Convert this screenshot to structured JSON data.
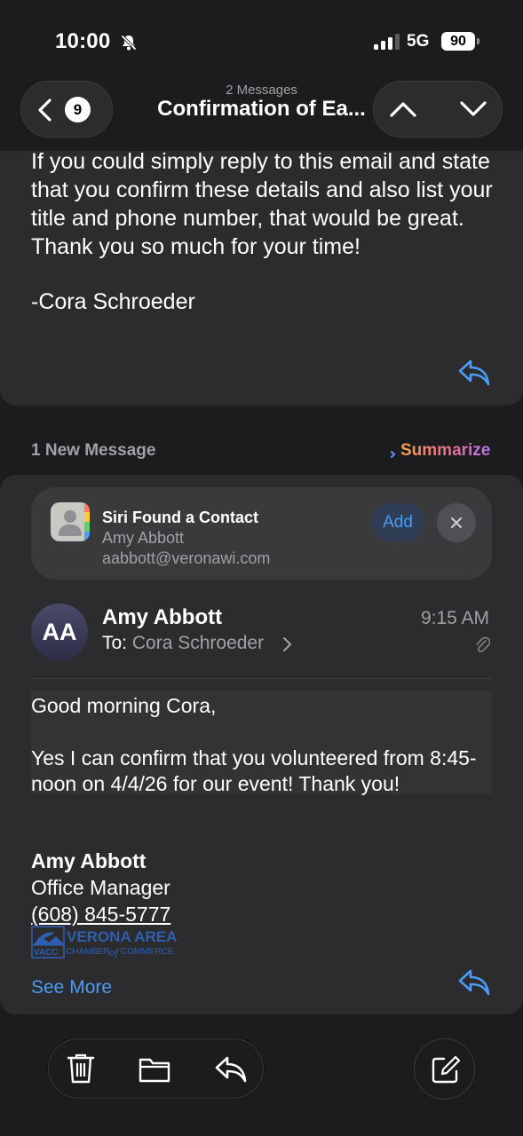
{
  "status_bar": {
    "time": "10:00",
    "network": "5G",
    "battery": "90"
  },
  "nav": {
    "message_count": "9",
    "subtitle": "2 Messages",
    "title": "Confirmation of Ea..."
  },
  "previous_message": {
    "body": "If you could simply reply to this email and state that you confirm these details and also list your title and phone number, that would be great. Thank you so much for your time!",
    "signature": "-Cora Schroeder"
  },
  "new_message_bar": {
    "label": "1 New Message",
    "summarize": "Summarize"
  },
  "siri_contact": {
    "title": "Siri Found a Contact",
    "name": "Amy Abbott",
    "email": "aabbott@veronawi.com",
    "add_label": "Add"
  },
  "message": {
    "avatar_initials": "AA",
    "sender": "Amy Abbott",
    "to_label": "To:",
    "to_name": "Cora Schroeder",
    "time": "9:15 AM",
    "greeting": "Good morning Cora,",
    "body": "Yes I can confirm that you volunteered from 8:45-noon on 4/4/26 for our event! Thank you!",
    "signature_name": "Amy Abbott",
    "signature_role": "Office Manager",
    "signature_phone": "(608) 845-5777",
    "logo": {
      "abbr": "VACC",
      "line1": "VERONA AREA",
      "line2_a": "CHAMBER",
      "line2_of": "of",
      "line2_b": "COMMERCE"
    },
    "see_more": "See More"
  },
  "colors": {
    "accent": "#4a9cf5",
    "background": "#1c1c1e",
    "card": "#2c2c2e",
    "secondary_text": "#a1a1a6"
  },
  "icons": [
    "bell-slash-icon",
    "signal-icon",
    "chevron-left-icon",
    "chevron-up-icon",
    "chevron-down-icon",
    "reply-icon",
    "summarize-icon",
    "contacts-icon",
    "close-icon",
    "paperclip-icon",
    "trash-icon",
    "folder-icon",
    "compose-icon"
  ]
}
